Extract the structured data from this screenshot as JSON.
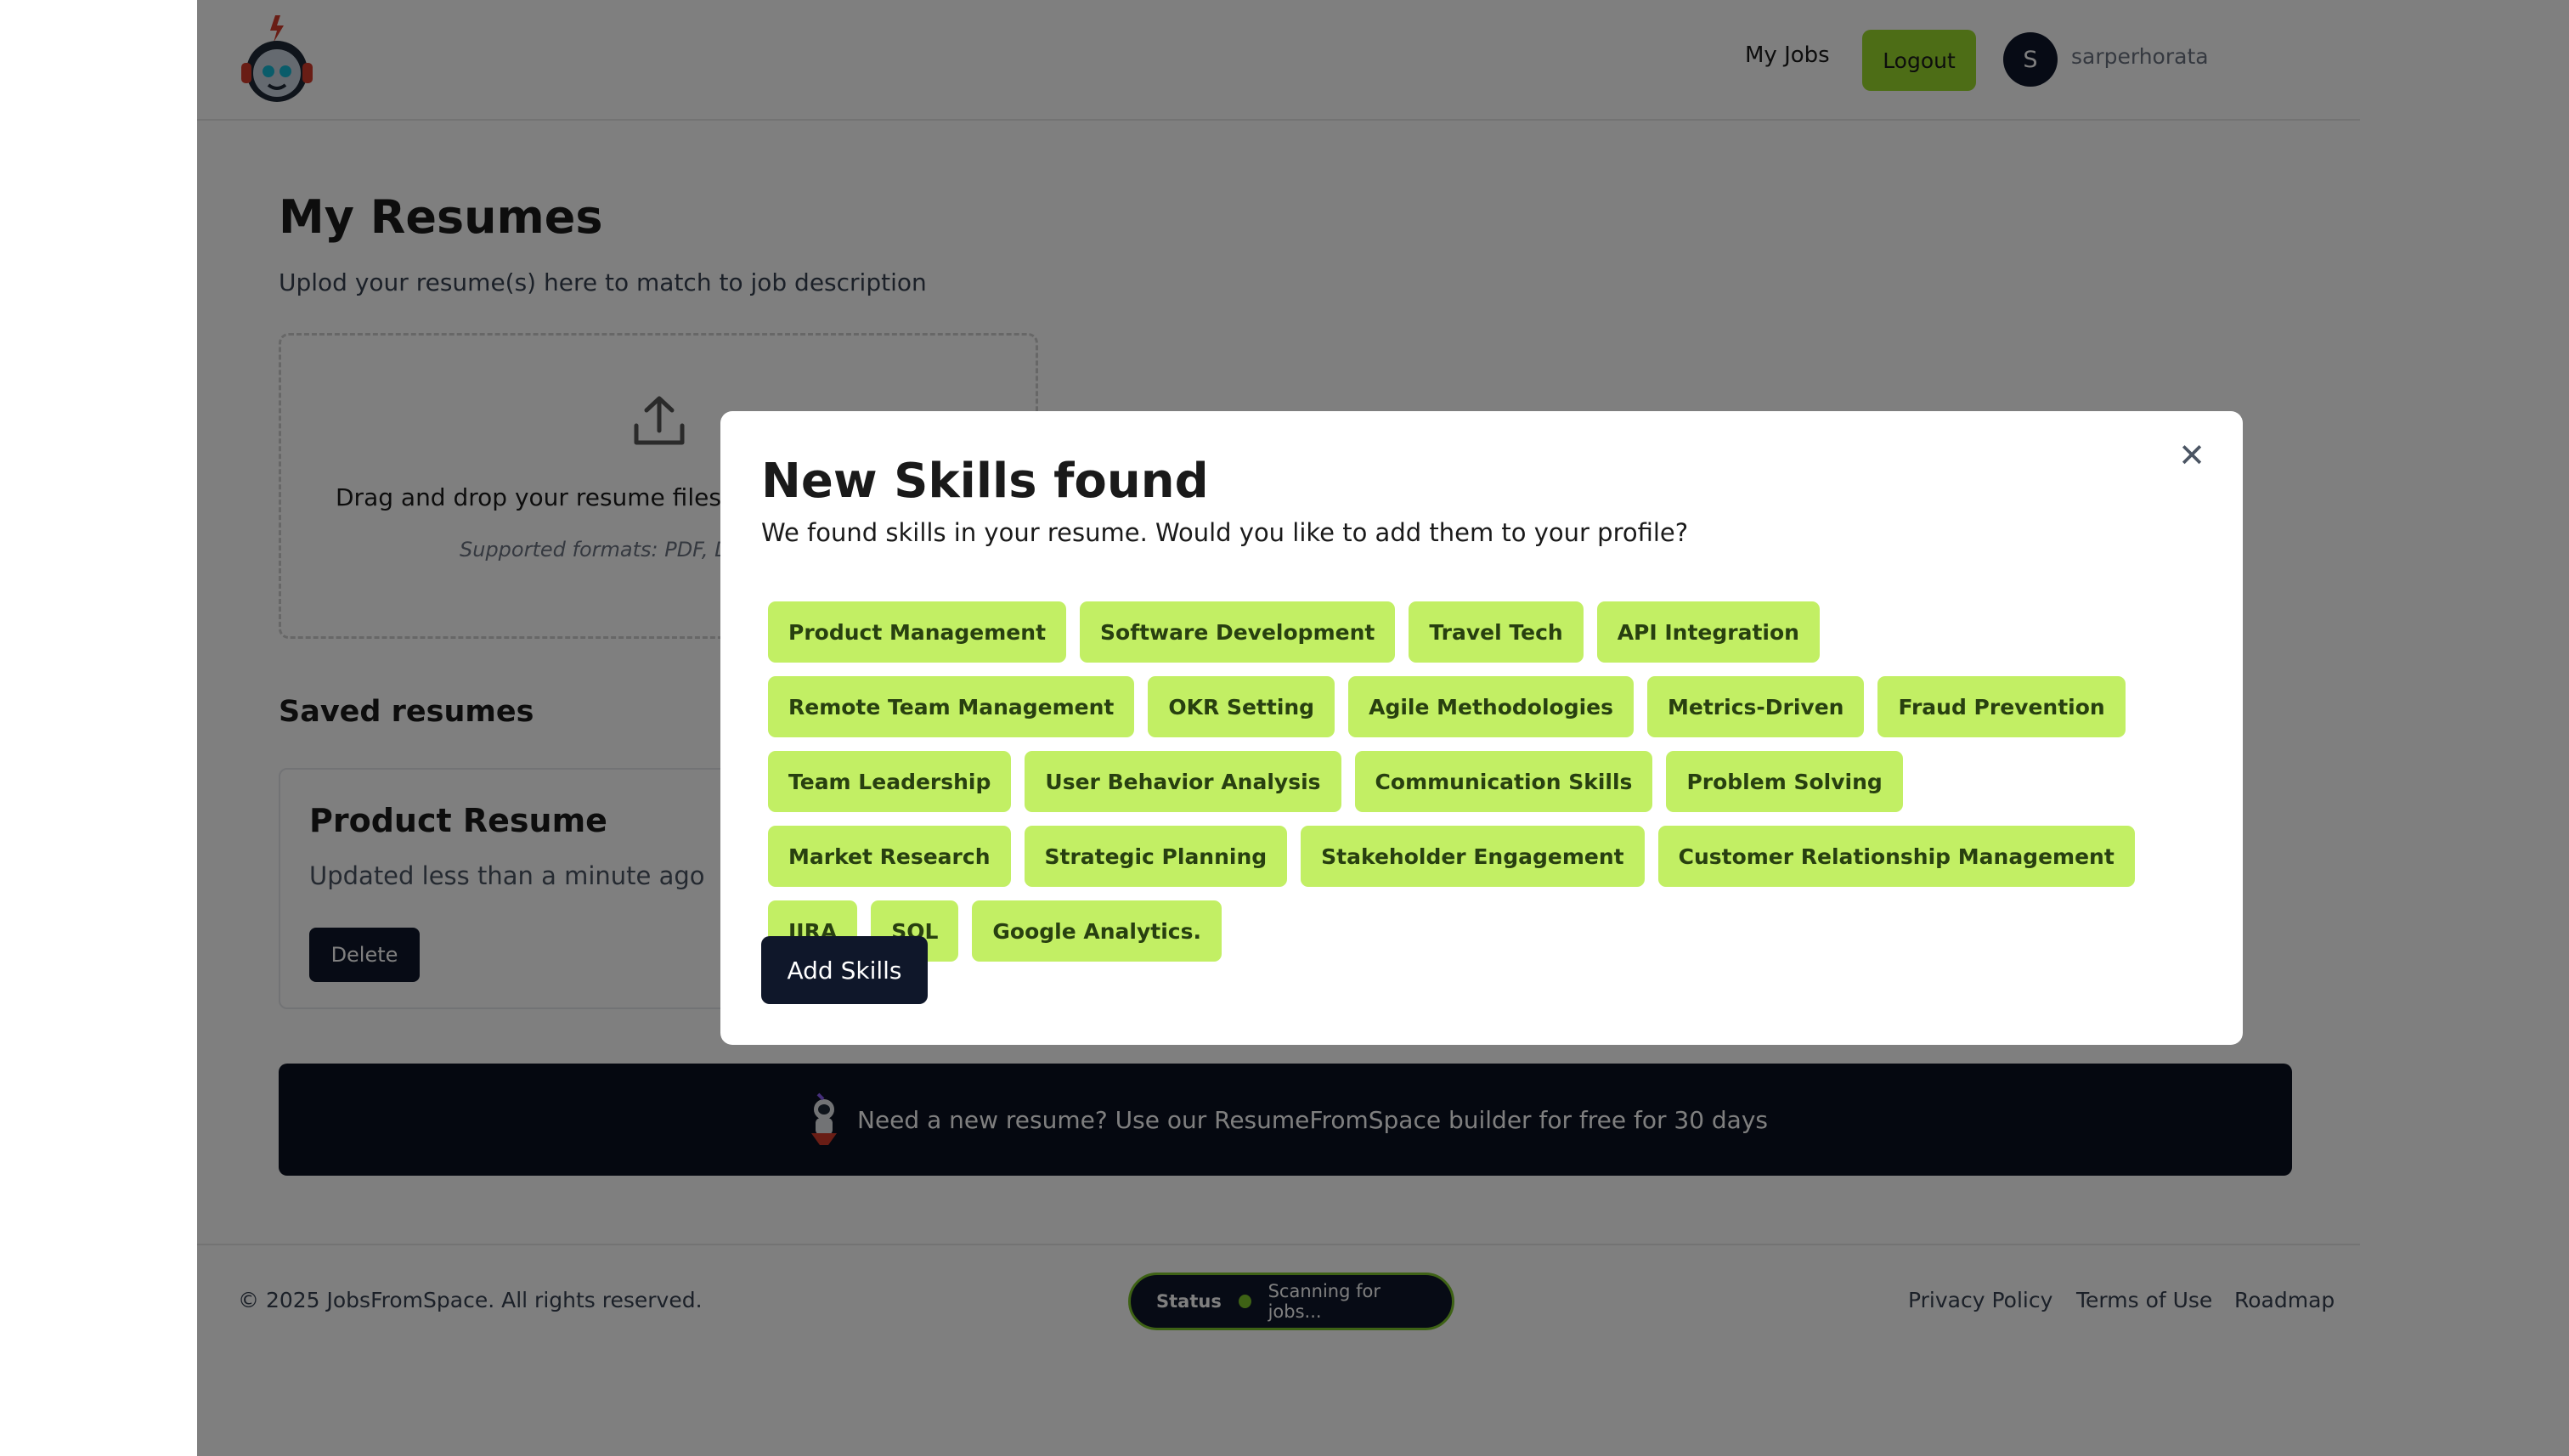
{
  "header": {
    "logo_icon": "robot-logo-icon",
    "nav_myjobs": "My Jobs",
    "logout_label": "Logout",
    "avatar_initial": "S",
    "username": "sarperhorata",
    "accent_color": "#9adb2c"
  },
  "main": {
    "title": "My Resumes",
    "subtitle": "Uplod your resume(s) here to match to job description",
    "dropzone": {
      "icon": "upload-icon",
      "text": "Drag and drop your resume files here",
      "formats": "Supported formats: PDF, DOCX"
    },
    "saved_title": "Saved resumes",
    "resume": {
      "title": "Product Resume",
      "updated": "Updated less than a minute ago",
      "delete_label": "Delete"
    },
    "banner": {
      "icon": "astronaut-rocket-icon",
      "text": "Need a new resume? Use our ResumeFromSpace builder for free for 30 days"
    }
  },
  "footer": {
    "copyright": "© 2025 JobsFromSpace. All rights reserved.",
    "status_label": "Status",
    "status_text": "Scanning for jobs...",
    "links": {
      "privacy": "Privacy Policy",
      "terms": "Terms of Use",
      "roadmap": "Roadmap"
    }
  },
  "modal": {
    "close_icon": "close-icon",
    "title": "New Skills found",
    "subtitle": "We found skills in your resume. Would you like to add them to your profile?",
    "skills": [
      "Product Management",
      "Software Development",
      "Travel Tech",
      "API Integration",
      "Remote Team Management",
      "OKR Setting",
      "Agile Methodologies",
      "Metrics-Driven",
      "Fraud Prevention",
      "Team Leadership",
      "User Behavior Analysis",
      "Communication Skills",
      "Problem Solving",
      "Market Research",
      "Strategic Planning",
      "Stakeholder Engagement",
      "Customer Relationship Management",
      "JIRA",
      "SQL",
      "Google Analytics."
    ],
    "add_label": "Add Skills",
    "chip_color": "#c2ef64"
  }
}
